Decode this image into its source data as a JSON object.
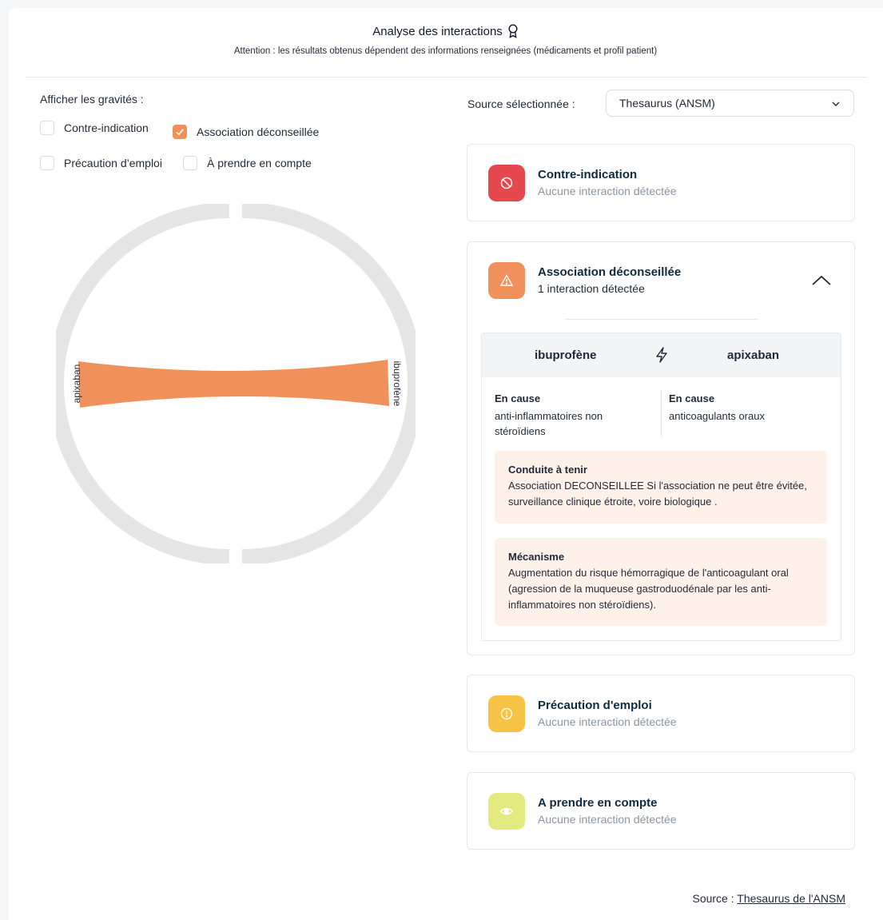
{
  "header": {
    "title": "Analyse des interactions",
    "subtitle": "Attention : les résultats obtenus dépendent des informations renseignées (médicaments et profil patient)"
  },
  "filters": {
    "label": "Afficher les gravités :",
    "options": [
      {
        "label": "Contre-indication",
        "checked": false
      },
      {
        "label": "Association déconseillée",
        "checked": true
      },
      {
        "label": "Précaution d’emploi",
        "checked": false
      },
      {
        "label": "À prendre en compte",
        "checked": false
      }
    ]
  },
  "source": {
    "label": "Source sélectionnée :",
    "selected": "Thesaurus (ANSM)"
  },
  "chord": {
    "left_label": "apixaban",
    "right_label": "ibuprofène",
    "ribbon_color": "#f0905a",
    "ring_color": "#e5e5e5"
  },
  "panels": [
    {
      "title": "Contre-indication",
      "subtitle": "Aucune interaction détectée",
      "color": "#e5484d",
      "icon": "ban-icon"
    },
    {
      "title": "Association déconseillée",
      "subtitle": "1 interaction détectée",
      "color": "#f0905a",
      "icon": "warning-icon",
      "expanded": true
    },
    {
      "title": "Précaution d'emploi",
      "subtitle": "Aucune interaction détectée",
      "color": "#f6c344",
      "icon": "alert-circle-icon"
    },
    {
      "title": "A prendre en compte",
      "subtitle": "Aucune interaction détectée",
      "color": "#e3ea80",
      "icon": "eye-icon"
    }
  ],
  "interaction": {
    "drug_a": "ibuprofène",
    "drug_b": "apixaban",
    "cause_a_title": "En cause",
    "cause_a_value": "anti-inflammatoires non stéroïdiens",
    "cause_b_title": "En cause",
    "cause_b_value": "anticoagulants oraux",
    "conduct_title": "Conduite à tenir",
    "conduct_text": "Association DECONSEILLEE Si l'association ne peut être évitée, surveillance clinique étroite, voire biologique .",
    "mechanism_title": "Mécanisme",
    "mechanism_text": "Augmentation du risque hémorragique de l'anticoagulant oral (agression de la muqueuse gastroduodénale par les anti-inflammatoires non stéroïdiens)."
  },
  "footer": {
    "prefix": "Source :",
    "link": "Thesaurus de l'ANSM"
  }
}
